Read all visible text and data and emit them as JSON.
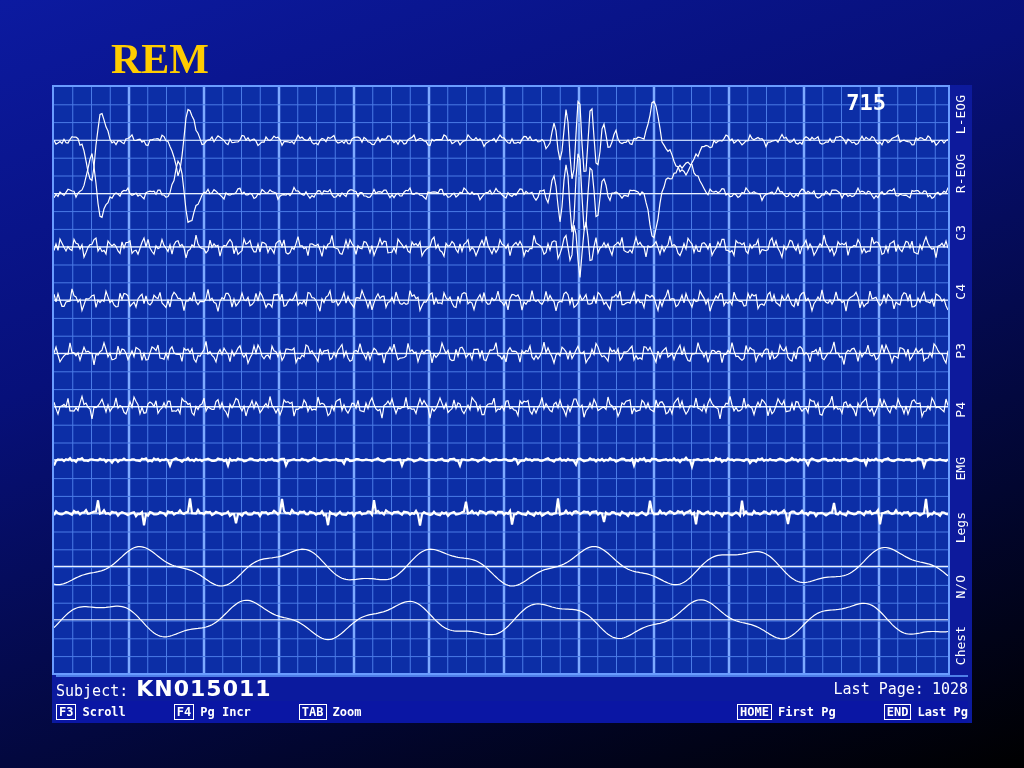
{
  "slide": {
    "title": "REM"
  },
  "screen": {
    "page_number": "715",
    "channels": [
      {
        "label": "L-EOG",
        "kind": "eog"
      },
      {
        "label": "R-EOG",
        "kind": "eog"
      },
      {
        "label": "C3",
        "kind": "eeg"
      },
      {
        "label": "C4",
        "kind": "eeg"
      },
      {
        "label": "P3",
        "kind": "eeg"
      },
      {
        "label": "P4",
        "kind": "eeg"
      },
      {
        "label": "EMG",
        "kind": "emg"
      },
      {
        "label": "Legs",
        "kind": "legs"
      },
      {
        "label": "N/O",
        "kind": "resp"
      },
      {
        "label": "Chest",
        "kind": "resp"
      }
    ],
    "subject_label": "Subject:",
    "subject": "KN015011",
    "last_page_label": "Last Page:",
    "last_page": "1028",
    "left_keys": [
      {
        "key": "F3",
        "action": "Scroll"
      },
      {
        "key": "F4",
        "action": "Pg Incr"
      },
      {
        "key": "TAB",
        "action": "Zoom"
      }
    ],
    "right_keys": [
      {
        "key": "HOME",
        "action": "First Pg"
      },
      {
        "key": "END",
        "action": "Last Pg"
      }
    ]
  }
}
